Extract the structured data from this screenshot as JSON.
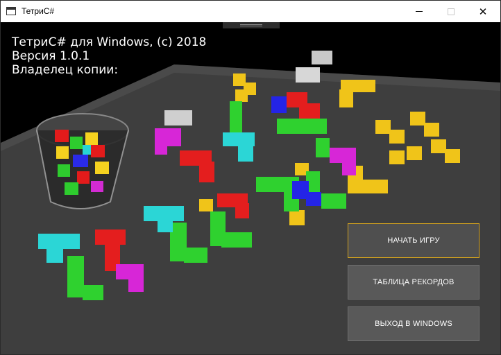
{
  "window": {
    "title": "ТетриС#",
    "controls": {
      "minimize": "minimize",
      "maximize": "maximize",
      "close": "✕"
    }
  },
  "info": {
    "line1": "ТетриС# для Windows, (c) 2018",
    "line2": "Версия 1.0.1",
    "line3": "Владелец копии:"
  },
  "menu": {
    "start_label": "НАЧАТЬ ИГРУ",
    "records_label": "ТАБЛИЦА РЕКОРДОВ",
    "exit_label": "ВЫХОД В WINDOWS"
  },
  "colors": {
    "active_border": "#d2a21e",
    "button_bg": "#595959",
    "table": "#3d3d3d"
  }
}
